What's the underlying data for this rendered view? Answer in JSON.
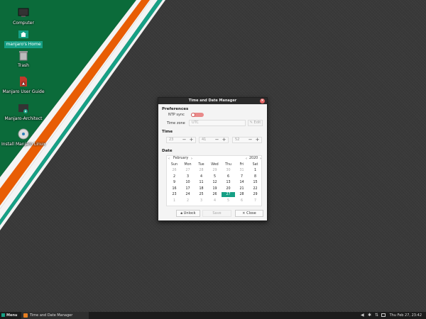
{
  "desktop": {
    "icons": [
      {
        "label": "Computer",
        "icon": "monitor-icon"
      },
      {
        "label": "manjaro's Home",
        "icon": "home-folder-icon",
        "selected": true
      },
      {
        "label": "Trash",
        "icon": "trash-icon"
      },
      {
        "label": "Manjaro User Guide",
        "icon": "pdf-icon"
      },
      {
        "label": "Manjaro-Architect",
        "icon": "terminal-icon"
      },
      {
        "label": "Install Manjaro Linux",
        "icon": "install-disc-icon"
      }
    ],
    "colors": {
      "green": "#0b6b3a",
      "orange": "#e85d04",
      "teal": "#16a085",
      "accent": "#16a085"
    }
  },
  "window": {
    "title": "Time and Date Manager",
    "close_glyph": "×",
    "preferences_heading": "Preferences",
    "ntp_label": "NTP sync",
    "ntp_enabled": false,
    "timezone_label": "Time zone",
    "timezone_value": "UTC",
    "edit_label": "Edit",
    "time_heading": "Time",
    "hours": "23",
    "minutes": "41",
    "seconds": "52",
    "minus": "−",
    "plus": "+",
    "date_heading": "Date",
    "calendar": {
      "month": "February",
      "year": "2020",
      "prev": "‹",
      "next": "›",
      "daynames": [
        "Sun",
        "Mon",
        "Tue",
        "Wed",
        "Thu",
        "Fri",
        "Sat"
      ],
      "weeks": [
        [
          "26",
          "27",
          "28",
          "29",
          "30",
          "31",
          "1"
        ],
        [
          "2",
          "3",
          "4",
          "5",
          "6",
          "7",
          "8"
        ],
        [
          "9",
          "10",
          "11",
          "12",
          "13",
          "14",
          "15"
        ],
        [
          "16",
          "17",
          "18",
          "19",
          "20",
          "21",
          "22"
        ],
        [
          "23",
          "24",
          "25",
          "26",
          "27",
          "28",
          "29"
        ],
        [
          "1",
          "2",
          "3",
          "4",
          "5",
          "6",
          "7"
        ]
      ],
      "selected_day": "27"
    },
    "unlock_label": "Unlock",
    "save_label": "Save",
    "close_label": "Close"
  },
  "taskbar": {
    "menu_label": "Menu",
    "task_label": "Time and Date Manager",
    "clock": "Thu Feb 27, 23:42"
  }
}
